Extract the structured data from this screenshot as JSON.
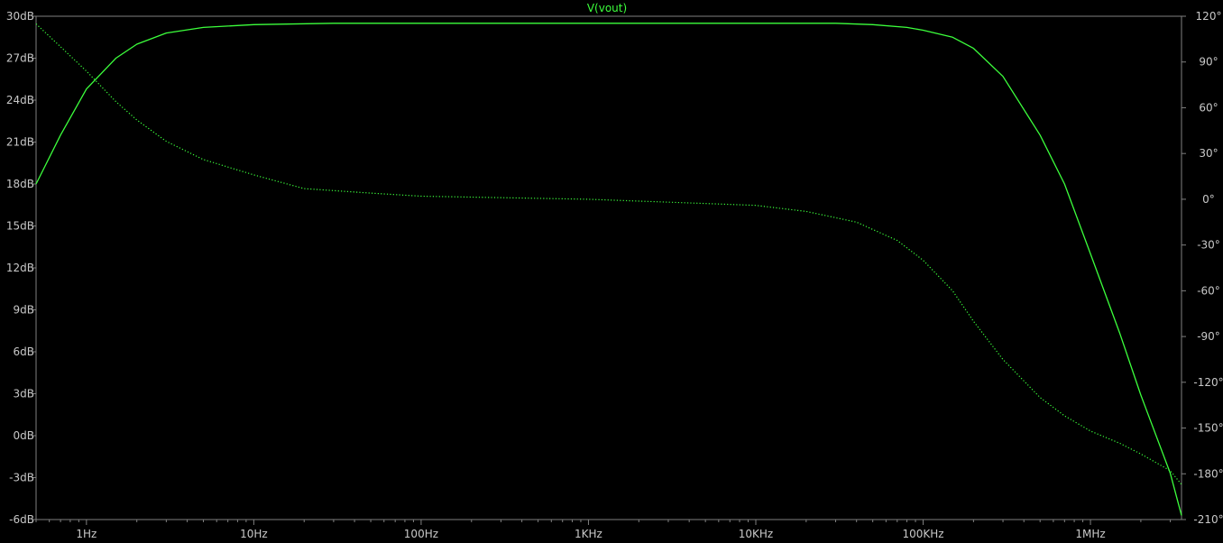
{
  "chart_data": {
    "type": "line",
    "title": "V(vout)",
    "x_scale": "log",
    "x_range_hz": [
      0.5,
      3500000
    ],
    "xticks": [
      {
        "label": "1Hz",
        "value": 1
      },
      {
        "label": "10Hz",
        "value": 10
      },
      {
        "label": "100Hz",
        "value": 100
      },
      {
        "label": "1KHz",
        "value": 1000
      },
      {
        "label": "10KHz",
        "value": 10000
      },
      {
        "label": "100KHz",
        "value": 100000
      },
      {
        "label": "1MHz",
        "value": 1000000
      }
    ],
    "y_left": {
      "unit": "dB",
      "range": [
        -6,
        30
      ],
      "ticks": [
        "30dB",
        "27dB",
        "24dB",
        "21dB",
        "18dB",
        "15dB",
        "12dB",
        "9dB",
        "6dB",
        "3dB",
        "0dB",
        "-3dB",
        "-6dB"
      ]
    },
    "y_right": {
      "unit": "°",
      "range": [
        -210,
        120
      ],
      "ticks": [
        "120°",
        "90°",
        "60°",
        "30°",
        "0°",
        "-30°",
        "-60°",
        "-90°",
        "-120°",
        "-150°",
        "-180°",
        "-210°"
      ]
    },
    "grid": false,
    "colors": {
      "background": "#000000",
      "trace": "#3cff3c",
      "axis": "#808080",
      "tick_text": "#c8c8c8"
    },
    "series": [
      {
        "name": "V(vout)",
        "quantity": "magnitude (dB)",
        "style": "solid",
        "x": [
          0.5,
          0.7,
          1,
          1.5,
          2,
          3,
          5,
          10,
          30,
          100,
          1000,
          10000,
          30000,
          50000,
          80000,
          100000,
          150000,
          200000,
          300000,
          500000,
          700000,
          1000000,
          1500000,
          2000000,
          3000000,
          3500000
        ],
        "y": [
          18,
          21.5,
          24.8,
          27,
          28,
          28.8,
          29.2,
          29.4,
          29.5,
          29.5,
          29.5,
          29.5,
          29.5,
          29.4,
          29.2,
          29.0,
          28.5,
          27.7,
          25.7,
          21.5,
          18.0,
          13.0,
          7.3,
          2.9,
          -2.7,
          -5.7
        ]
      },
      {
        "name": "V(vout)",
        "quantity": "phase (°)",
        "style": "dotted",
        "x": [
          0.5,
          0.7,
          1,
          1.5,
          2,
          3,
          5,
          10,
          20,
          50,
          100,
          1000,
          10000,
          20000,
          40000,
          70000,
          100000,
          150000,
          200000,
          300000,
          500000,
          700000,
          1000000,
          1500000,
          2000000,
          3000000,
          3500000
        ],
        "y": [
          115,
          100,
          84,
          64,
          52,
          38,
          26,
          16,
          7,
          4,
          2,
          0,
          -4,
          -8,
          -15,
          -27,
          -40,
          -60,
          -80,
          -105,
          -130,
          -142,
          -152,
          -160,
          -167,
          -178,
          -187
        ]
      }
    ]
  }
}
